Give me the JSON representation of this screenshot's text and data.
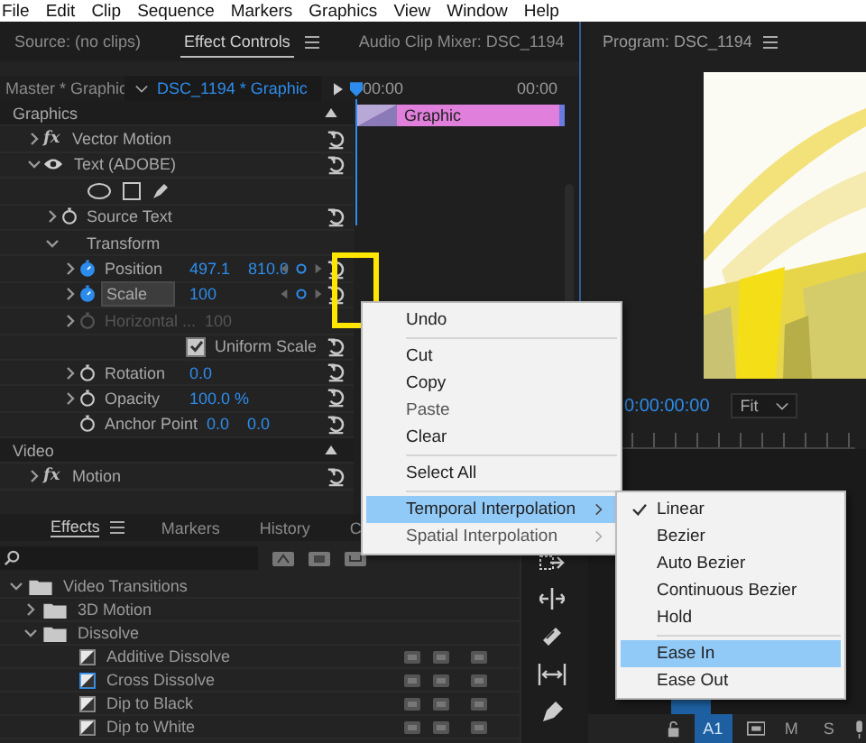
{
  "menu_bar": [
    "File",
    "Edit",
    "Clip",
    "Sequence",
    "Markers",
    "Graphics",
    "View",
    "Window",
    "Help"
  ],
  "effect_controls": {
    "tabs": [
      {
        "label": "Source: (no clips)",
        "selected": false
      },
      {
        "label": "Effect Controls",
        "selected": true
      },
      {
        "label": "Audio Clip Mixer: DSC_1194",
        "selected": false
      }
    ],
    "master_label": "Master * Graphic",
    "clip_label": "DSC_1194 * Graphic",
    "time_start": "00:00",
    "time_end": "00:00",
    "clip_bar": "Graphic",
    "rows": [
      {
        "kind": "section",
        "label": "Graphics",
        "expanded": true,
        "children": [
          {
            "kind": "effect",
            "badge": "fx",
            "label": "Vector Motion",
            "expanded": false,
            "reset": true
          },
          {
            "kind": "effect",
            "visible": true,
            "label": "Text (ADOBE)",
            "expanded": true,
            "reset": true,
            "children": [
              {
                "kind": "shapes"
              },
              {
                "kind": "property",
                "label": "Source Text",
                "expanded": false,
                "animated": false,
                "reset": true
              },
              {
                "kind": "group",
                "label": "Transform",
                "expanded": true,
                "children": [
                  {
                    "kind": "property",
                    "label": "Position",
                    "expanded": false,
                    "animated": true,
                    "selected": false,
                    "values": [
                      "497.1",
                      "810.0"
                    ],
                    "keyframe_nav": true,
                    "reset": true
                  },
                  {
                    "kind": "property",
                    "label": "Scale",
                    "expanded": false,
                    "animated": true,
                    "selected": true,
                    "values": [
                      "100"
                    ],
                    "keyframe_nav": true,
                    "reset": true
                  },
                  {
                    "kind": "property",
                    "label": "Horizontal ...",
                    "expanded": false,
                    "animated": false,
                    "disabled": true,
                    "values": [
                      "100"
                    ]
                  },
                  {
                    "kind": "checkbox",
                    "label": "Uniform Scale",
                    "checked": true,
                    "reset": true
                  },
                  {
                    "kind": "property",
                    "label": "Rotation",
                    "expanded": false,
                    "animated": false,
                    "values": [
                      "0.0"
                    ],
                    "reset": true
                  },
                  {
                    "kind": "property",
                    "label": "Opacity",
                    "expanded": false,
                    "animated": false,
                    "values": [
                      "100.0 %"
                    ],
                    "reset": true
                  },
                  {
                    "kind": "property",
                    "label": "Anchor Point",
                    "animated": false,
                    "values": [
                      "0.0",
                      "0.0"
                    ],
                    "reset": true
                  }
                ]
              }
            ]
          }
        ]
      },
      {
        "kind": "section",
        "label": "Video",
        "expanded": true,
        "children": [
          {
            "kind": "effect",
            "badge": "fx",
            "label": "Motion",
            "expanded": false,
            "reset": true
          }
        ]
      }
    ]
  },
  "program": {
    "title": "Program: DSC_1194",
    "timecode": "0:00:00:00",
    "zoom": "Fit"
  },
  "effects_panel": {
    "tabs": [
      {
        "label": "Effects",
        "selected": true
      },
      {
        "label": "Markers",
        "selected": false
      },
      {
        "label": "History",
        "selected": false
      },
      {
        "label": "C",
        "selected": false
      }
    ],
    "tree": [
      {
        "kind": "folder",
        "label": "Video Transitions",
        "expanded": true,
        "children": [
          {
            "kind": "folder",
            "label": "3D Motion",
            "expanded": false
          },
          {
            "kind": "folder",
            "label": "Dissolve",
            "expanded": true,
            "children": [
              {
                "kind": "effect",
                "label": "Additive Dissolve",
                "selected": false
              },
              {
                "kind": "effect",
                "label": "Cross Dissolve",
                "selected": true
              },
              {
                "kind": "effect",
                "label": "Dip to Black",
                "selected": false
              },
              {
                "kind": "effect",
                "label": "Dip to White",
                "selected": false
              }
            ]
          }
        ]
      }
    ]
  },
  "track_header": [
    {
      "label": "A1",
      "selected": true
    },
    {
      "label": "M",
      "selected": false
    },
    {
      "label": "S",
      "selected": false
    }
  ],
  "context_menu": [
    {
      "kind": "item",
      "label": "Undo",
      "disabled": false,
      "selected": false
    },
    {
      "kind": "separator"
    },
    {
      "kind": "item",
      "label": "Cut",
      "disabled": false,
      "selected": false
    },
    {
      "kind": "item",
      "label": "Copy",
      "disabled": false,
      "selected": false
    },
    {
      "kind": "item",
      "label": "Paste",
      "disabled": true,
      "selected": false
    },
    {
      "kind": "item",
      "label": "Clear",
      "disabled": false,
      "selected": false
    },
    {
      "kind": "separator"
    },
    {
      "kind": "item",
      "label": "Select All",
      "disabled": false,
      "selected": false
    },
    {
      "kind": "separator"
    },
    {
      "kind": "item",
      "label": "Temporal Interpolation",
      "disabled": false,
      "selected": true,
      "submenu": true
    },
    {
      "kind": "item",
      "label": "Spatial Interpolation",
      "disabled": true,
      "selected": false,
      "submenu": true
    }
  ],
  "submenu": [
    {
      "kind": "item",
      "label": "Linear",
      "checked": true,
      "selected": false
    },
    {
      "kind": "item",
      "label": "Bezier",
      "checked": false,
      "selected": false
    },
    {
      "kind": "item",
      "label": "Auto Bezier",
      "checked": false,
      "selected": false
    },
    {
      "kind": "item",
      "label": "Continuous Bezier",
      "checked": false,
      "selected": false
    },
    {
      "kind": "item",
      "label": "Hold",
      "checked": false,
      "selected": false
    },
    {
      "kind": "separator"
    },
    {
      "kind": "item",
      "label": "Ease In",
      "checked": false,
      "selected": true
    },
    {
      "kind": "item",
      "label": "Ease Out",
      "checked": false,
      "selected": false
    }
  ]
}
